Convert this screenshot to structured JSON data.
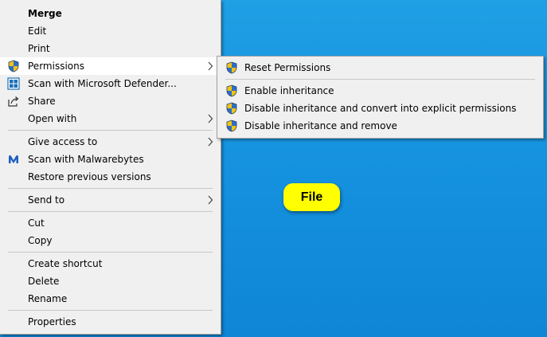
{
  "menu": {
    "items": [
      {
        "label": "Merge"
      },
      {
        "label": "Edit"
      },
      {
        "label": "Print"
      },
      {
        "label": "Permissions"
      },
      {
        "label": "Scan with Microsoft Defender..."
      },
      {
        "label": "Share"
      },
      {
        "label": "Open with"
      },
      {
        "label": "Give access to"
      },
      {
        "label": "Scan with Malwarebytes"
      },
      {
        "label": "Restore previous versions"
      },
      {
        "label": "Send to"
      },
      {
        "label": "Cut"
      },
      {
        "label": "Copy"
      },
      {
        "label": "Create shortcut"
      },
      {
        "label": "Delete"
      },
      {
        "label": "Rename"
      },
      {
        "label": "Properties"
      }
    ]
  },
  "submenu": {
    "items": [
      {
        "label": "Reset Permissions"
      },
      {
        "label": "Enable inheritance"
      },
      {
        "label": "Disable inheritance and convert into explicit permissions"
      },
      {
        "label": "Disable inheritance and remove"
      }
    ]
  },
  "badge": {
    "text": "File"
  },
  "colors": {
    "desktop": "#138fdd",
    "menu_bg": "#f0f0f0",
    "highlight": "#ffffff",
    "badge": "#ffff00",
    "shield_blue": "#2f6fc4",
    "shield_yellow": "#f2c314"
  },
  "icons": {
    "permissions": "uac-shield-icon",
    "defender": "defender-scan-icon",
    "share": "share-icon",
    "malwarebytes": "malwarebytes-icon",
    "submenu": "uac-shield-icon",
    "submenu_arrow": "chevron-right-icon"
  }
}
